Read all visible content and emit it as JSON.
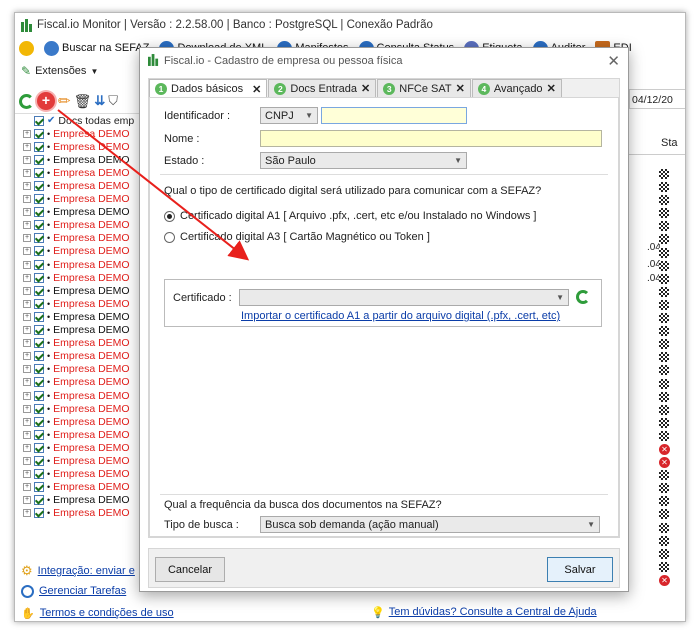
{
  "app": {
    "title": "Fiscal.io Monitor | Versão : 2.2.58.00 | Banco : PostgreSQL | Conexão Padrão"
  },
  "toolbar": {
    "items": [
      {
        "label": "Buscar na SEFAZ",
        "icon": "search-globe-icon"
      },
      {
        "label": "Download de XML",
        "icon": "globe-icon"
      },
      {
        "label": "Manifestos",
        "icon": "globe-icon"
      },
      {
        "label": "Consulta Status",
        "icon": "globe-icon"
      },
      {
        "label": "Etiqueta",
        "icon": "tag-icon"
      },
      {
        "label": "Auditor",
        "icon": "globe-icon"
      },
      {
        "label": "EDI",
        "icon": "truck-icon"
      }
    ],
    "extensions_label": "Extensões"
  },
  "tree": {
    "header": "Docs todas emp",
    "rows": [
      {
        "label": "Empresa DEMO",
        "color": "#e0201c"
      },
      {
        "label": "Empresa DEMO",
        "color": "#e0201c"
      },
      {
        "label": "Empresa DEMO",
        "color": "#111111"
      },
      {
        "label": "Empresa DEMO",
        "color": "#e0201c"
      },
      {
        "label": "Empresa DEMO",
        "color": "#e0201c"
      },
      {
        "label": "Empresa DEMO",
        "color": "#e0201c"
      },
      {
        "label": "Empresa DEMO",
        "color": "#111111"
      },
      {
        "label": "Empresa DEMO",
        "color": "#e0201c"
      },
      {
        "label": "Empresa DEMO",
        "color": "#e0201c"
      },
      {
        "label": "Empresa DEMO",
        "color": "#e0201c"
      },
      {
        "label": "Empresa DEMO",
        "color": "#e0201c"
      },
      {
        "label": "Empresa DEMO",
        "color": "#e0201c"
      },
      {
        "label": "Empresa DEMO",
        "color": "#111111"
      },
      {
        "label": "Empresa DEMO",
        "color": "#e0201c"
      },
      {
        "label": "Empresa DEMO",
        "color": "#111111"
      },
      {
        "label": "Empresa DEMO",
        "color": "#111111"
      },
      {
        "label": "Empresa DEMO",
        "color": "#e0201c"
      },
      {
        "label": "Empresa DEMO",
        "color": "#e0201c"
      },
      {
        "label": "Empresa DEMO",
        "color": "#e0201c"
      },
      {
        "label": "Empresa DEMO",
        "color": "#e0201c"
      },
      {
        "label": "Empresa DEMO",
        "color": "#e0201c"
      },
      {
        "label": "Empresa DEMO",
        "color": "#e0201c"
      },
      {
        "label": "Empresa DEMO",
        "color": "#e0201c"
      },
      {
        "label": "Empresa DEMO",
        "color": "#e0201c"
      },
      {
        "label": "Empresa DEMO",
        "color": "#e0201c"
      },
      {
        "label": "Empresa DEMO",
        "color": "#e0201c"
      },
      {
        "label": "Empresa DEMO",
        "color": "#e0201c"
      },
      {
        "label": "Empresa DEMO",
        "color": "#e0201c"
      },
      {
        "label": "Empresa DEMO",
        "color": "#111111"
      },
      {
        "label": "Empresa DEMO",
        "color": "#e0201c"
      }
    ]
  },
  "links": {
    "integracao": "Integração: enviar e",
    "gerenciar": "Gerenciar Tarefas",
    "termos": "Termos e condições de uso",
    "duvidas": "Tem dúvidas? Consulte a Central de Ajuda"
  },
  "right": {
    "date": "04/12/20",
    "sta_header": "Sta",
    "values": [
      ".04",
      ".04",
      ".04"
    ]
  },
  "dialog": {
    "title": "Fiscal.io - Cadastro de empresa ou pessoa física",
    "tabs": [
      {
        "num": "1",
        "label": "Dados básicos"
      },
      {
        "num": "2",
        "label": "Docs Entrada"
      },
      {
        "num": "3",
        "label": "NFCe SAT"
      },
      {
        "num": "4",
        "label": "Avançado"
      }
    ],
    "form": {
      "identificador_label": "Identificador :",
      "identificador_type": "CNPJ",
      "nome_label": "Nome :",
      "estado_label": "Estado :",
      "estado_value": "São Paulo",
      "question_cert": "Qual o tipo de certificado digital será utilizado para comunicar com a SEFAZ?",
      "radio_a1": "Certificado digital A1 [ Arquivo .pfx, .cert, etc e/ou Instalado no Windows ]",
      "radio_a3": "Certificado digital A3 [ Cartão Magnético ou Token ]",
      "certificado_label": "Certificado :",
      "import_link": "Importar o certificado A1 a partir do arquivo digital (.pfx, .cert, etc)",
      "question_freq": "Qual a frequência da busca dos documentos na SEFAZ?",
      "tipo_busca_label": "Tipo de busca :",
      "tipo_busca_value": "Busca sob demanda (ação manual)"
    },
    "buttons": {
      "cancel": "Cancelar",
      "save": "Salvar"
    }
  },
  "colors": {
    "accent_blue": "#0b3da8",
    "tab_green": "#5cb85c",
    "arrow_red": "#e8201c"
  }
}
